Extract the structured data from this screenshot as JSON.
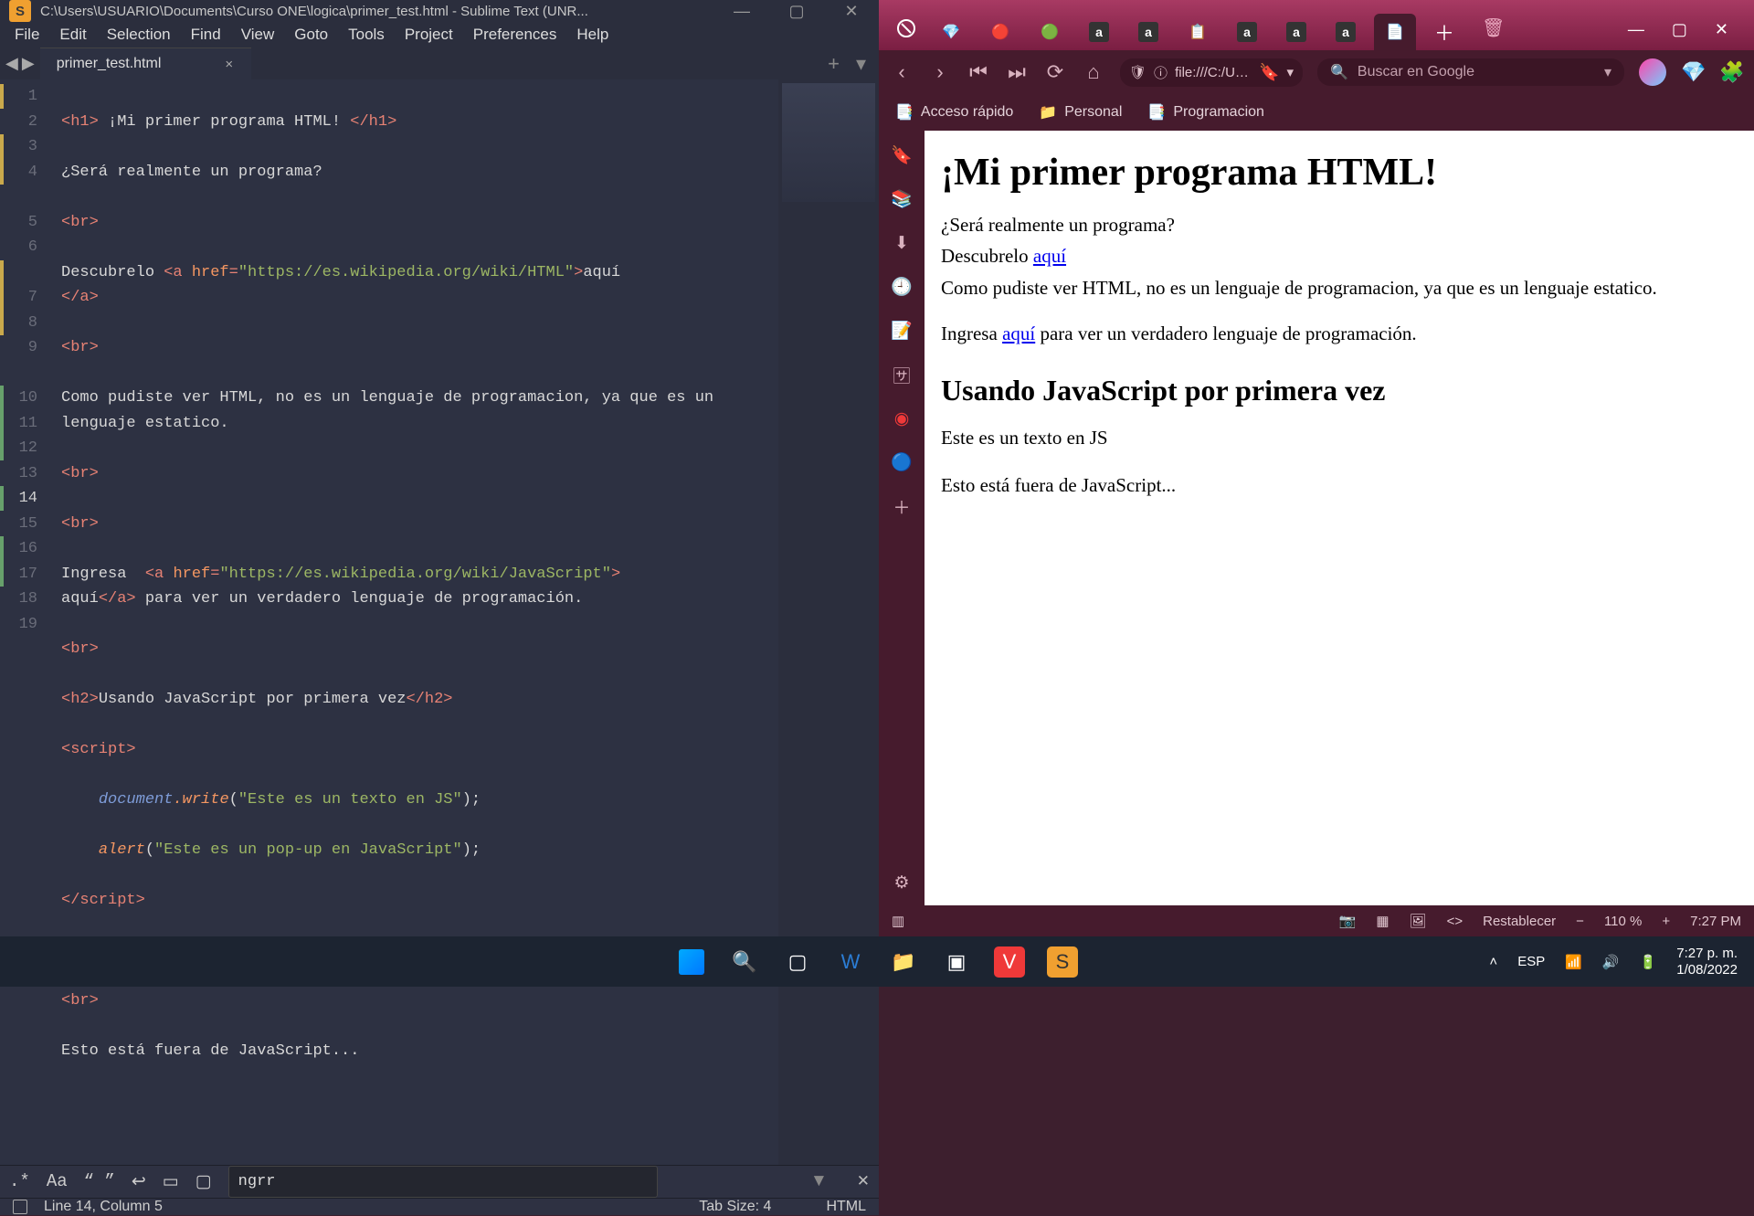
{
  "sublime": {
    "title": "C:\\Users\\USUARIO\\Documents\\Curso ONE\\logica\\primer_test.html - Sublime Text (UNR...",
    "menu": [
      "File",
      "Edit",
      "Selection",
      "Find",
      "View",
      "Goto",
      "Tools",
      "Project",
      "Preferences",
      "Help"
    ],
    "tab_name": "primer_test.html",
    "find_text": "ngrr",
    "status_pos": "Line 14, Column 5",
    "status_tab": "Tab Size: 4",
    "status_lang": "HTML",
    "line_nums": [
      "1",
      "2",
      "3",
      "4",
      "5",
      "6",
      "7",
      "8",
      "9",
      "10",
      "11",
      "12",
      "13",
      "14",
      "15",
      "16",
      "17",
      "18",
      "19"
    ],
    "code": {
      "l1a": "h1",
      "l1t": " ¡Mi primer programa HTML! ",
      "l1b": "h1",
      "l2": "¿Será realmente un programa?",
      "br": "br",
      "l4a": "Descubrelo ",
      "l4tag": "a",
      "l4attr": "href",
      "l4str": "\"https://es.wikipedia.org/wiki/HTML\"",
      "l4end": "aquí",
      "l4c": "a",
      "l6": "Como pudiste ver HTML, no es un lenguaje de programacion, ya que es un lenguaje estatico.",
      "l9a": "Ingresa  ",
      "l9tag": "a",
      "l9attr": "href",
      "l9str": "\"https://es.wikipedia.org/wiki/JavaScript\"",
      "l9b": "aquí",
      "l9c": "a",
      "l9d": " para ver un verdadero lenguaje de programación.",
      "h2o": "h2",
      "l11": "Usando JavaScript por primera vez",
      "h2c": "h2",
      "scr": "script",
      "doc": "document",
      "wr": ".write",
      "s13": "(\"Este es un texto en JS\");",
      "al": "alert",
      "s14": "(\"Este es un pop-up en JavaScript\");",
      "l18": "Esto está fuera de JavaScript..."
    }
  },
  "vivaldi": {
    "url_short": "file:///C:/U…",
    "search_ph": "Buscar en Google",
    "bookmarks": [
      "Acceso rápido",
      "Personal",
      "Programacion"
    ],
    "page": {
      "h1": "¡Mi primer programa HTML!",
      "p1": "¿Será realmente un programa?",
      "p2a": "Descubrelo ",
      "p2link": "aquí",
      "p3": "Como pudiste ver HTML, no es un lenguaje de programacion, ya que es un lenguaje estatico.",
      "p4a": "Ingresa ",
      "p4link": "aquí",
      "p4b": " para ver un verdadero lenguaje de programación.",
      "h2": "Usando JavaScript por primera vez",
      "p5": "Este es un texto en JS",
      "p6": "Esto está fuera de JavaScript..."
    },
    "status": {
      "reset": "Restablecer",
      "zoom": "110 %",
      "time": "7:27 PM"
    }
  },
  "taskbar": {
    "lang": "ESP",
    "time": "7:27 p. m.",
    "date": "1/08/2022"
  }
}
